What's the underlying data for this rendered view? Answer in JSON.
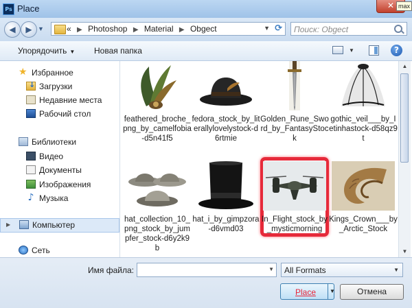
{
  "window": {
    "title": "Place",
    "app_icon": "Ps",
    "close_glyph": "✕",
    "tooltip": "max"
  },
  "nav": {
    "back_glyph": "◀",
    "forward_glyph": "▶",
    "breadcrumb_lead": "«",
    "breadcrumbs": [
      "Photoshop",
      "Material",
      "Obgect"
    ],
    "search_placeholder": "Поиск: Obgect"
  },
  "toolbar": {
    "organize_label": "Упорядочить",
    "new_folder_label": "Новая папка",
    "help_glyph": "?"
  },
  "sidebar": {
    "items": [
      {
        "label": "Избранное",
        "icon": "star-icon"
      },
      {
        "label": "Загрузки",
        "icon": "downloads-icon"
      },
      {
        "label": "Недавние места",
        "icon": "recent-places-icon"
      },
      {
        "label": "Рабочий стол",
        "icon": "desktop-icon"
      },
      {
        "label": "Библиотеки",
        "icon": "libraries-icon"
      },
      {
        "label": "Видео",
        "icon": "video-icon"
      },
      {
        "label": "Документы",
        "icon": "documents-icon"
      },
      {
        "label": "Изображения",
        "icon": "images-icon"
      },
      {
        "label": "Музыка",
        "icon": "music-icon"
      },
      {
        "label": "Компьютер",
        "icon": "computer-icon"
      },
      {
        "label": "Сеть",
        "icon": "network-icon"
      }
    ]
  },
  "files": [
    {
      "name": "feathered_broche_png_by_camelfobia-d5n41f5",
      "thumb": "feather-brooch"
    },
    {
      "name": "fedora_stock_by_literallylovelystock-d6rtmie",
      "thumb": "fedora-hat"
    },
    {
      "name": "Golden_Rune_Sword_by_FantasyStock",
      "thumb": "sword"
    },
    {
      "name": "gothic_veil___by_Ietinhastock-d58qz9t",
      "thumb": "veil"
    },
    {
      "name": "hat_collection_10_png_stock_by_jumpfer_stock-d6y2k9b",
      "thumb": "hat-collection"
    },
    {
      "name": "hat_i_by_gimpzora-d6vmd03",
      "thumb": "top-hat"
    },
    {
      "name": "In_Flight_stock_by_mysticmorning",
      "thumb": "aircraft",
      "selected": true
    },
    {
      "name": "Kings_Crown___by_Arctic_Stock",
      "thumb": "ram-horn"
    }
  ],
  "bottom": {
    "filename_label": "Имя файла:",
    "filename_value": "",
    "format_value": "All Formats",
    "place_label": "Place",
    "cancel_label": "Отмена"
  },
  "colors": {
    "selection": "#e62a3a",
    "titlebar": "#bcd7f2"
  }
}
